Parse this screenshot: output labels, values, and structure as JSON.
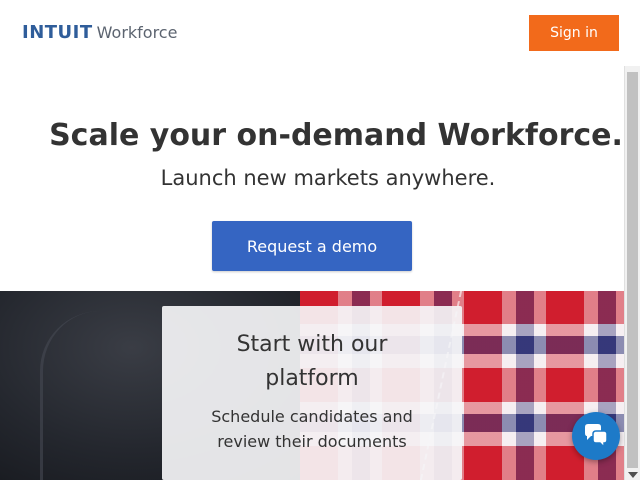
{
  "header": {
    "logo_brand": "INTUIT",
    "logo_product": "Workforce",
    "signin_label": "Sign in"
  },
  "hero": {
    "title": "Scale your on-demand Workforce.",
    "subtitle": "Launch new markets anywhere.",
    "demo_label": "Request a demo"
  },
  "card": {
    "title_line1": "Start with our",
    "title_line2": "platform",
    "text_line1": "Schedule candidates and",
    "text_line2": "review their documents",
    "cut_text": "..."
  },
  "chat": {
    "icon": "chat-bubbles-icon"
  },
  "colors": {
    "signin": "#f26a1b",
    "demo": "#3565c2",
    "chat": "#1d7ac8",
    "brand": "#2f5d9a"
  }
}
